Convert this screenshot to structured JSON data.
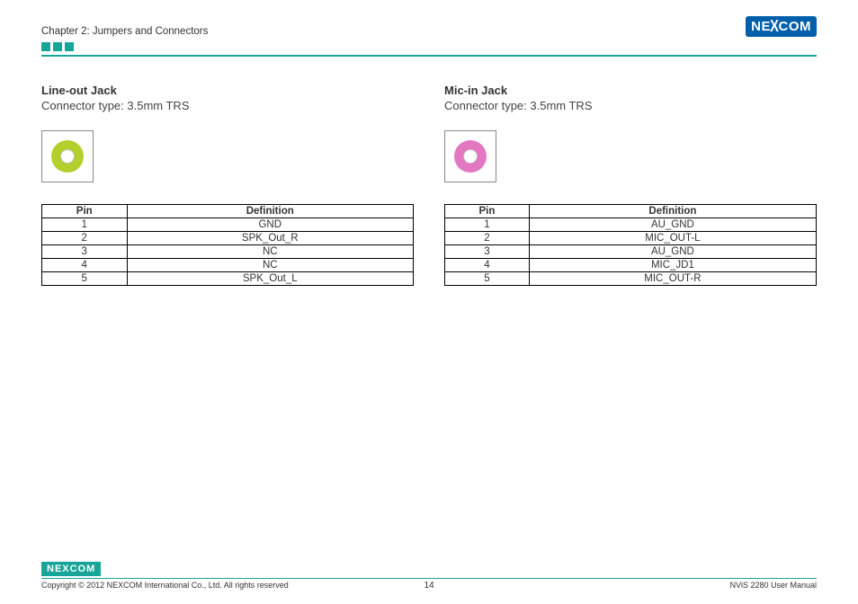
{
  "header": {
    "chapter": "Chapter 2: Jumpers and Connectors",
    "logo_text": "NE",
    "logo_x": "X",
    "logo_text2": "COM"
  },
  "left": {
    "title": "Line-out Jack",
    "sub": "Connector type: 3.5mm TRS",
    "headers": {
      "pin": "Pin",
      "def": "Definition"
    },
    "rows": [
      {
        "pin": "1",
        "def": "GND"
      },
      {
        "pin": "2",
        "def": "SPK_Out_R"
      },
      {
        "pin": "3",
        "def": "NC"
      },
      {
        "pin": "4",
        "def": "NC"
      },
      {
        "pin": "5",
        "def": "SPK_Out_L"
      }
    ]
  },
  "right": {
    "title": "Mic-in Jack",
    "sub": "Connector type: 3.5mm TRS",
    "headers": {
      "pin": "Pin",
      "def": "Definition"
    },
    "rows": [
      {
        "pin": "1",
        "def": "AU_GND"
      },
      {
        "pin": "2",
        "def": "MIC_OUT-L"
      },
      {
        "pin": "3",
        "def": "AU_GND"
      },
      {
        "pin": "4",
        "def": "MIC_JD1"
      },
      {
        "pin": "5",
        "def": "MIC_OUT-R"
      }
    ]
  },
  "footer": {
    "logo": "NEXCOM",
    "copyright": "Copyright © 2012 NEXCOM International Co., Ltd. All rights reserved",
    "page": "14",
    "doc": "NViS 2280 User Manual"
  }
}
